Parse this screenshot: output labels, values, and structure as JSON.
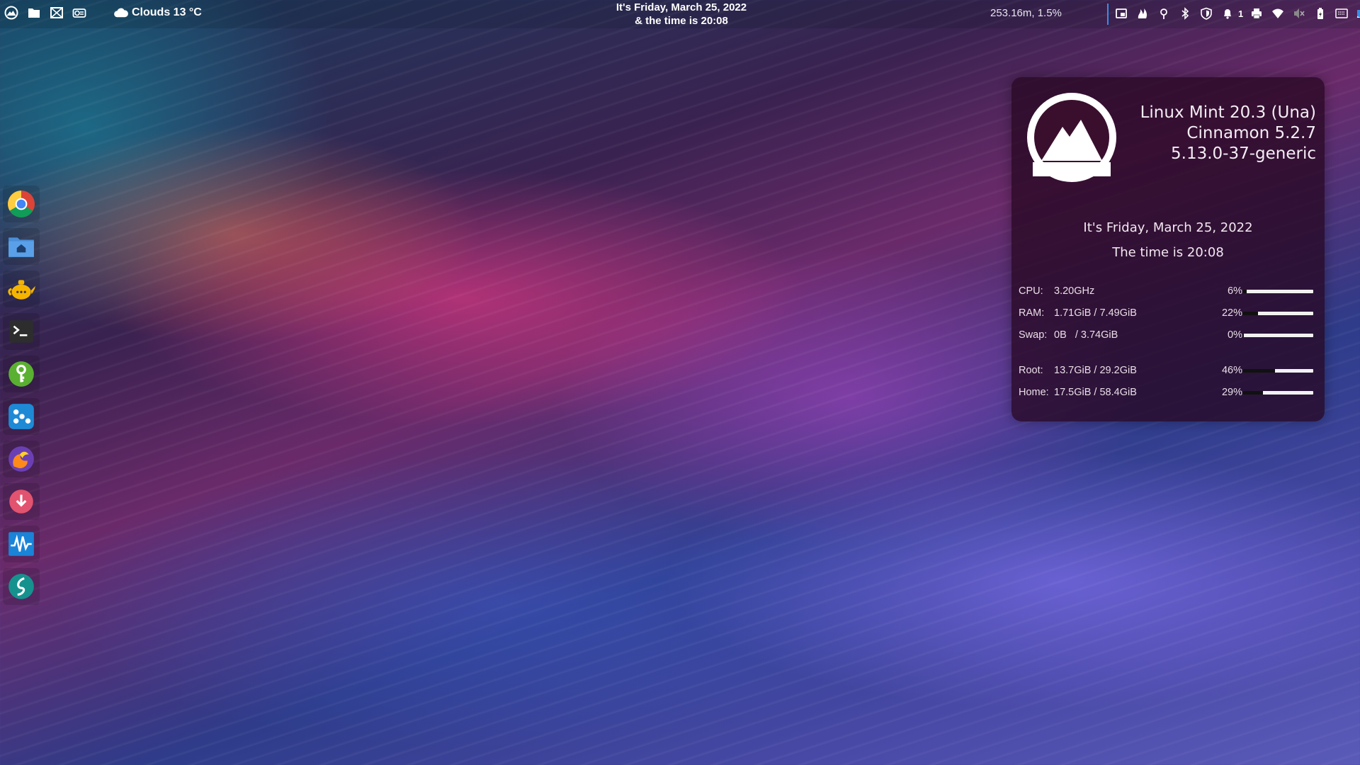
{
  "panel": {
    "weather": "Clouds 13 °C",
    "clock_line1": "It's Friday, March 25, 2022",
    "clock_line2": "& the time is 20:08",
    "memory": "253.16m, 1.5%",
    "notification_count": "1",
    "left_icons": [
      "menu-icon",
      "files-icon",
      "mail-icon",
      "toggle-icon"
    ],
    "tray_icons": [
      "window-icon",
      "flame-icon",
      "location-icon",
      "bluetooth-icon",
      "shield-icon",
      "bell-icon",
      "printer-icon",
      "wifi-icon",
      "mute-icon",
      "battery-icon",
      "keyboard-icon",
      "desktop-icon"
    ]
  },
  "dock": {
    "items": [
      "chrome-icon",
      "home-folder-icon",
      "teapot-icon",
      "terminal-icon",
      "keyring-icon",
      "dots-app-icon",
      "firefox-icon",
      "download-icon",
      "system-monitor-icon",
      "sublime-icon"
    ]
  },
  "desklet": {
    "os": "Linux Mint 20.3 (Una)",
    "de": "Cinnamon 5.2.7",
    "kernel": "5.13.0-37-generic",
    "date": "It's Friday, March 25, 2022",
    "time": "The time is 20:08",
    "stats": [
      {
        "label": "CPU:",
        "value": "3.20GHz",
        "percent": "6%",
        "level": 6
      },
      {
        "label": "RAM:",
        "value": "1.71GiB / 7.49GiB",
        "percent": "22%",
        "level": 22
      },
      {
        "label": "Swap:",
        "value": "0B   / 3.74GiB",
        "percent": "0%",
        "level": 0
      },
      {
        "label": "Root:",
        "value": "13.7GiB / 29.2GiB",
        "percent": "46%",
        "level": 46
      },
      {
        "label": "Home:",
        "value": "17.5GiB / 58.4GiB",
        "percent": "29%",
        "level": 29
      }
    ]
  },
  "colors": {
    "desklet_bg": "#28081f",
    "panel_divider": "#3a8ee6"
  }
}
